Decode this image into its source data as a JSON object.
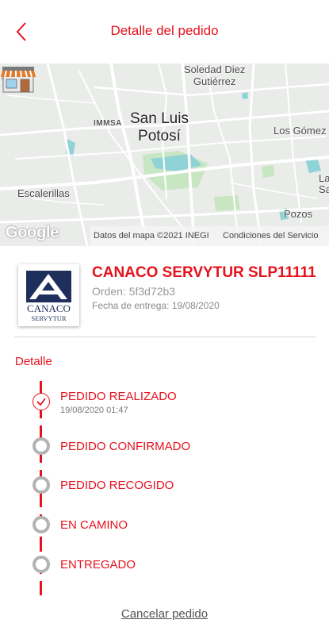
{
  "header": {
    "title": "Detalle del pedido",
    "back_icon": "chevron-left-icon"
  },
  "map": {
    "labels": {
      "soledad": "Soledad Diez\nGutiérrez",
      "immsa": "IMMSA",
      "city": "San Luis\nPotosí",
      "gomez": "Los Gómez",
      "escalerillas": "Escalerillas",
      "la": "La\nSa",
      "pozos": "Pozos"
    },
    "google": "Google",
    "attribution": "Datos del mapa ©2021 INEGI",
    "terms": "Condiciones del Servicio",
    "colors": {
      "land": "#e9ece9",
      "water": "#8fd3d6",
      "park": "#c8e6c2",
      "road": "#ffffff"
    }
  },
  "store": {
    "logo_text": "CANACO",
    "logo_subtext": "SERVYTUR",
    "name": "CANACO SERVYTUR SLP11111",
    "order": "Orden: 5f3d72b3",
    "delivery": "Fecha de entrega: 19/08/2020"
  },
  "detail": {
    "title": "Detalle",
    "steps": [
      {
        "label": "PEDIDO REALIZADO",
        "time": "19/08/2020 01:47",
        "status": "done"
      },
      {
        "label": "PEDIDO CONFIRMADO",
        "status": "pending"
      },
      {
        "label": "PEDIDO RECOGIDO",
        "status": "pending"
      },
      {
        "label": "EN CAMINO",
        "status": "pending"
      },
      {
        "label": "ENTREGADO",
        "status": "pending"
      }
    ]
  },
  "cancel_label": "Cancelar pedido",
  "colors": {
    "accent": "#e5121d",
    "pending": "#b3b3b3",
    "logo_navy": "#1f2f5c"
  }
}
